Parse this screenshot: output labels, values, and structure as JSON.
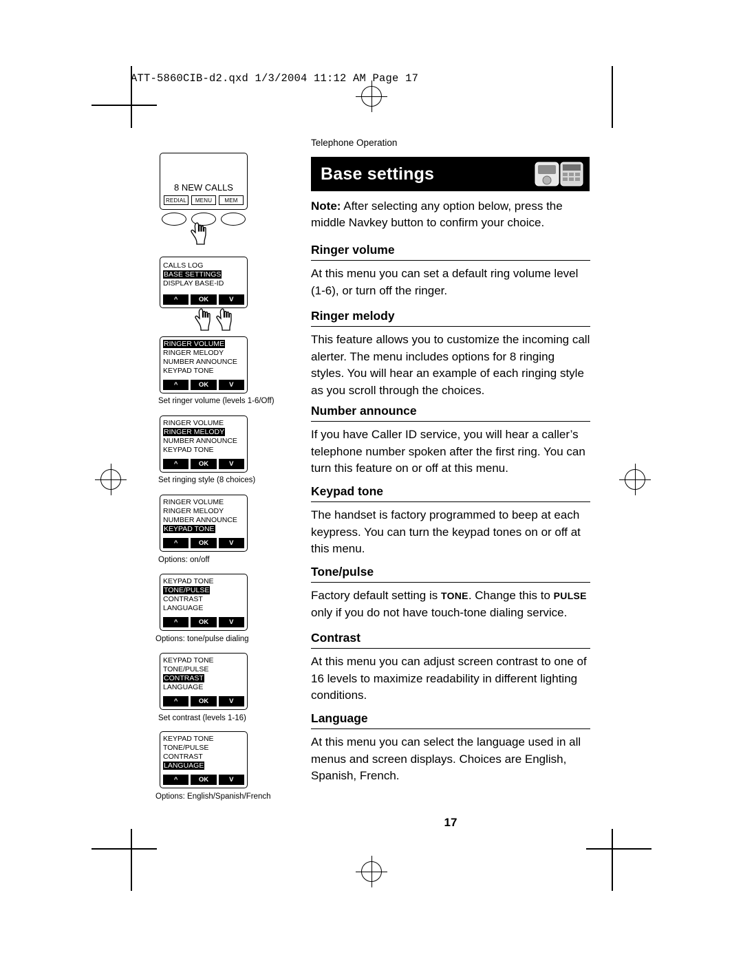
{
  "printmarks": {
    "filestamp": "ATT-5860CIB-d2.qxd  1/3/2004  11:12 AM  Page 17"
  },
  "page": {
    "running_head": "Telephone Operation",
    "title": "Base settings",
    "title_icon": "cordless-phone-icon",
    "page_number": "17",
    "note_label": "Note:",
    "note_text": " After selecting any option below, press the middle Navkey button to confirm your choice.",
    "sections": [
      {
        "heading": "Ringer volume",
        "body": "At this menu you can set a default ring volume level (1-6), or turn off the ringer."
      },
      {
        "heading": "Ringer melody",
        "body": "This feature allows you to customize the incoming call alerter. The menu includes options for 8 ringing styles. You will hear an example of each ringing style as you scroll through the choices."
      },
      {
        "heading": "Number announce",
        "body": "If you have Caller ID service, you will hear a caller’s telephone number spoken after the first ring. You can turn this feature on or off at this menu."
      },
      {
        "heading": "Keypad tone",
        "body": "The handset is factory programmed to beep at each keypress. You can turn the keypad tones on or off at this menu."
      },
      {
        "heading": "Tone/pulse",
        "body_pre": "Factory default setting is ",
        "body_sc1": "TONE",
        "body_mid": ". Change this to ",
        "body_sc2": "PULSE",
        "body_post": " only if you do not have touch-tone dialing service."
      },
      {
        "heading": "Contrast",
        "body": "At this menu you can adjust screen contrast to one of 16 levels to maximize readability in different lighting conditions."
      },
      {
        "heading": "Language",
        "body": "At this menu you can select the language used in all menus and screen displays. Choices are English, Spanish, French."
      }
    ]
  },
  "figures": {
    "handset": {
      "display_text": "8 NEW CALLS",
      "buttons": [
        "REDIAL",
        "MENU",
        "MEM"
      ]
    },
    "screens": [
      {
        "name": "menu-screen-base-settings",
        "rows": [
          "CALLS LOG",
          "BASE SETTINGS",
          "DISPLAY BASE-ID"
        ],
        "highlight": 1,
        "softkeys": [
          "^",
          "OK",
          "V"
        ],
        "caption": ""
      },
      {
        "name": "menu-screen-ringer-volume",
        "rows": [
          "RINGER VOLUME",
          "RINGER MELODY",
          "NUMBER ANNOUNCE",
          "KEYPAD TONE"
        ],
        "highlight": 0,
        "softkeys": [
          "^",
          "OK",
          "V"
        ],
        "caption": "Set ringer volume (levels 1-6/Off)"
      },
      {
        "name": "menu-screen-ringer-melody",
        "rows": [
          "RINGER VOLUME",
          "RINGER MELODY",
          "NUMBER ANNOUNCE",
          "KEYPAD TONE"
        ],
        "highlight": 1,
        "softkeys": [
          "^",
          "OK",
          "V"
        ],
        "caption": "Set ringing style (8 choices)"
      },
      {
        "name": "menu-screen-keypad-tone",
        "rows": [
          "RINGER VOLUME",
          "RINGER MELODY",
          "NUMBER ANNOUNCE",
          "KEYPAD TONE"
        ],
        "highlight": 3,
        "softkeys": [
          "^",
          "OK",
          "V"
        ],
        "caption": "Options: on/off"
      },
      {
        "name": "menu-screen-tone-pulse",
        "rows": [
          "KEYPAD TONE",
          "TONE/PULSE",
          "CONTRAST",
          "LANGUAGE"
        ],
        "highlight": 1,
        "softkeys": [
          "^",
          "OK",
          "V"
        ],
        "caption": "Options: tone/pulse dialing"
      },
      {
        "name": "menu-screen-contrast",
        "rows": [
          "KEYPAD TONE",
          "TONE/PULSE",
          "CONTRAST",
          "LANGUAGE"
        ],
        "highlight": 2,
        "softkeys": [
          "^",
          "OK",
          "V"
        ],
        "caption": "Set contrast (levels 1-16)"
      },
      {
        "name": "menu-screen-language",
        "rows": [
          "KEYPAD TONE",
          "TONE/PULSE",
          "CONTRAST",
          "LANGUAGE"
        ],
        "highlight": 3,
        "softkeys": [
          "^",
          "OK",
          "V"
        ],
        "caption": "Options: English/Spanish/French"
      }
    ]
  }
}
